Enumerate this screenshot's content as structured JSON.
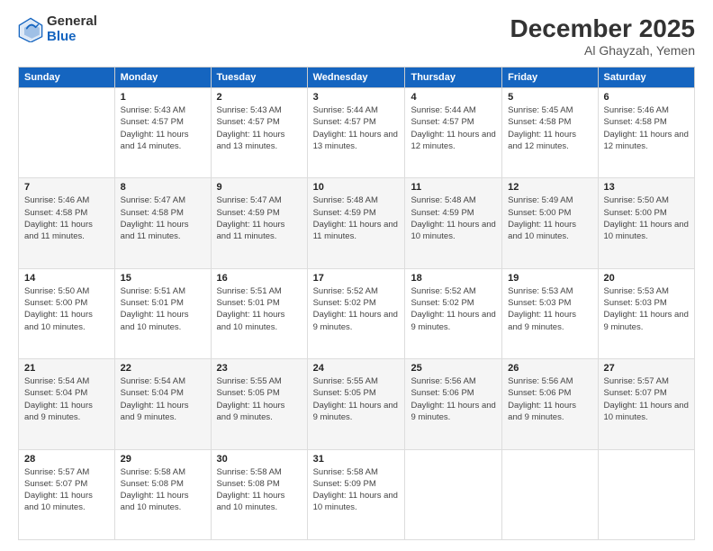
{
  "logo": {
    "general": "General",
    "blue": "Blue"
  },
  "title": "December 2025",
  "location": "Al Ghayzah, Yemen",
  "headers": [
    "Sunday",
    "Monday",
    "Tuesday",
    "Wednesday",
    "Thursday",
    "Friday",
    "Saturday"
  ],
  "weeks": [
    [
      {
        "day": "",
        "sunrise": "",
        "sunset": "",
        "daylight": ""
      },
      {
        "day": "1",
        "sunrise": "Sunrise: 5:43 AM",
        "sunset": "Sunset: 4:57 PM",
        "daylight": "Daylight: 11 hours and 14 minutes."
      },
      {
        "day": "2",
        "sunrise": "Sunrise: 5:43 AM",
        "sunset": "Sunset: 4:57 PM",
        "daylight": "Daylight: 11 hours and 13 minutes."
      },
      {
        "day": "3",
        "sunrise": "Sunrise: 5:44 AM",
        "sunset": "Sunset: 4:57 PM",
        "daylight": "Daylight: 11 hours and 13 minutes."
      },
      {
        "day": "4",
        "sunrise": "Sunrise: 5:44 AM",
        "sunset": "Sunset: 4:57 PM",
        "daylight": "Daylight: 11 hours and 12 minutes."
      },
      {
        "day": "5",
        "sunrise": "Sunrise: 5:45 AM",
        "sunset": "Sunset: 4:58 PM",
        "daylight": "Daylight: 11 hours and 12 minutes."
      },
      {
        "day": "6",
        "sunrise": "Sunrise: 5:46 AM",
        "sunset": "Sunset: 4:58 PM",
        "daylight": "Daylight: 11 hours and 12 minutes."
      }
    ],
    [
      {
        "day": "7",
        "sunrise": "Sunrise: 5:46 AM",
        "sunset": "Sunset: 4:58 PM",
        "daylight": "Daylight: 11 hours and 11 minutes."
      },
      {
        "day": "8",
        "sunrise": "Sunrise: 5:47 AM",
        "sunset": "Sunset: 4:58 PM",
        "daylight": "Daylight: 11 hours and 11 minutes."
      },
      {
        "day": "9",
        "sunrise": "Sunrise: 5:47 AM",
        "sunset": "Sunset: 4:59 PM",
        "daylight": "Daylight: 11 hours and 11 minutes."
      },
      {
        "day": "10",
        "sunrise": "Sunrise: 5:48 AM",
        "sunset": "Sunset: 4:59 PM",
        "daylight": "Daylight: 11 hours and 11 minutes."
      },
      {
        "day": "11",
        "sunrise": "Sunrise: 5:48 AM",
        "sunset": "Sunset: 4:59 PM",
        "daylight": "Daylight: 11 hours and 10 minutes."
      },
      {
        "day": "12",
        "sunrise": "Sunrise: 5:49 AM",
        "sunset": "Sunset: 5:00 PM",
        "daylight": "Daylight: 11 hours and 10 minutes."
      },
      {
        "day": "13",
        "sunrise": "Sunrise: 5:50 AM",
        "sunset": "Sunset: 5:00 PM",
        "daylight": "Daylight: 11 hours and 10 minutes."
      }
    ],
    [
      {
        "day": "14",
        "sunrise": "Sunrise: 5:50 AM",
        "sunset": "Sunset: 5:00 PM",
        "daylight": "Daylight: 11 hours and 10 minutes."
      },
      {
        "day": "15",
        "sunrise": "Sunrise: 5:51 AM",
        "sunset": "Sunset: 5:01 PM",
        "daylight": "Daylight: 11 hours and 10 minutes."
      },
      {
        "day": "16",
        "sunrise": "Sunrise: 5:51 AM",
        "sunset": "Sunset: 5:01 PM",
        "daylight": "Daylight: 11 hours and 10 minutes."
      },
      {
        "day": "17",
        "sunrise": "Sunrise: 5:52 AM",
        "sunset": "Sunset: 5:02 PM",
        "daylight": "Daylight: 11 hours and 9 minutes."
      },
      {
        "day": "18",
        "sunrise": "Sunrise: 5:52 AM",
        "sunset": "Sunset: 5:02 PM",
        "daylight": "Daylight: 11 hours and 9 minutes."
      },
      {
        "day": "19",
        "sunrise": "Sunrise: 5:53 AM",
        "sunset": "Sunset: 5:03 PM",
        "daylight": "Daylight: 11 hours and 9 minutes."
      },
      {
        "day": "20",
        "sunrise": "Sunrise: 5:53 AM",
        "sunset": "Sunset: 5:03 PM",
        "daylight": "Daylight: 11 hours and 9 minutes."
      }
    ],
    [
      {
        "day": "21",
        "sunrise": "Sunrise: 5:54 AM",
        "sunset": "Sunset: 5:04 PM",
        "daylight": "Daylight: 11 hours and 9 minutes."
      },
      {
        "day": "22",
        "sunrise": "Sunrise: 5:54 AM",
        "sunset": "Sunset: 5:04 PM",
        "daylight": "Daylight: 11 hours and 9 minutes."
      },
      {
        "day": "23",
        "sunrise": "Sunrise: 5:55 AM",
        "sunset": "Sunset: 5:05 PM",
        "daylight": "Daylight: 11 hours and 9 minutes."
      },
      {
        "day": "24",
        "sunrise": "Sunrise: 5:55 AM",
        "sunset": "Sunset: 5:05 PM",
        "daylight": "Daylight: 11 hours and 9 minutes."
      },
      {
        "day": "25",
        "sunrise": "Sunrise: 5:56 AM",
        "sunset": "Sunset: 5:06 PM",
        "daylight": "Daylight: 11 hours and 9 minutes."
      },
      {
        "day": "26",
        "sunrise": "Sunrise: 5:56 AM",
        "sunset": "Sunset: 5:06 PM",
        "daylight": "Daylight: 11 hours and 9 minutes."
      },
      {
        "day": "27",
        "sunrise": "Sunrise: 5:57 AM",
        "sunset": "Sunset: 5:07 PM",
        "daylight": "Daylight: 11 hours and 10 minutes."
      }
    ],
    [
      {
        "day": "28",
        "sunrise": "Sunrise: 5:57 AM",
        "sunset": "Sunset: 5:07 PM",
        "daylight": "Daylight: 11 hours and 10 minutes."
      },
      {
        "day": "29",
        "sunrise": "Sunrise: 5:58 AM",
        "sunset": "Sunset: 5:08 PM",
        "daylight": "Daylight: 11 hours and 10 minutes."
      },
      {
        "day": "30",
        "sunrise": "Sunrise: 5:58 AM",
        "sunset": "Sunset: 5:08 PM",
        "daylight": "Daylight: 11 hours and 10 minutes."
      },
      {
        "day": "31",
        "sunrise": "Sunrise: 5:58 AM",
        "sunset": "Sunset: 5:09 PM",
        "daylight": "Daylight: 11 hours and 10 minutes."
      },
      {
        "day": "",
        "sunrise": "",
        "sunset": "",
        "daylight": ""
      },
      {
        "day": "",
        "sunrise": "",
        "sunset": "",
        "daylight": ""
      },
      {
        "day": "",
        "sunrise": "",
        "sunset": "",
        "daylight": ""
      }
    ]
  ]
}
